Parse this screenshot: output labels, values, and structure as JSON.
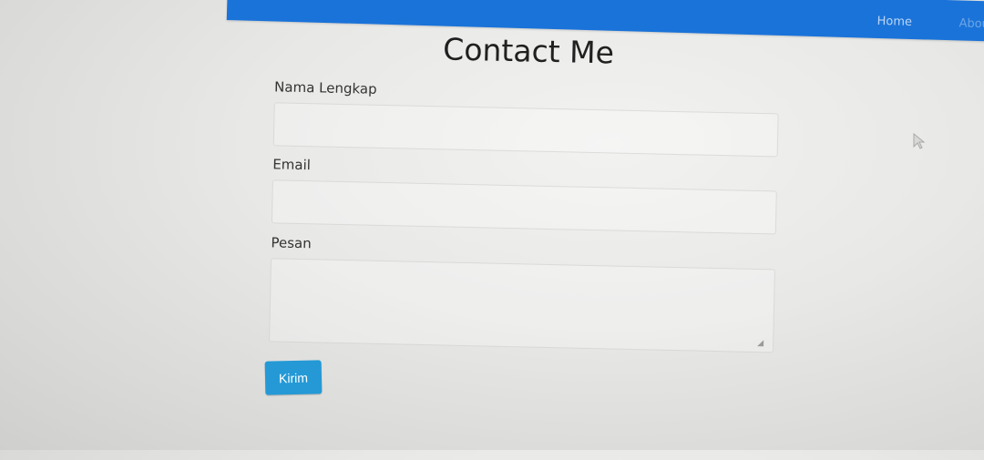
{
  "navbar": {
    "home_label": "Home",
    "about_label": "About"
  },
  "contact_form": {
    "title": "Contact Me",
    "name_label": "Nama Lengkap",
    "name_value": "",
    "email_label": "Email",
    "email_value": "",
    "message_label": "Pesan",
    "message_value": "",
    "submit_label": "Kirim"
  },
  "colors": {
    "navbar": "#1a73d9",
    "submit_button": "#2499d6"
  },
  "icons": {
    "pointer": "mouse-pointer-icon",
    "textarea_grip": "resize-grip-icon"
  }
}
